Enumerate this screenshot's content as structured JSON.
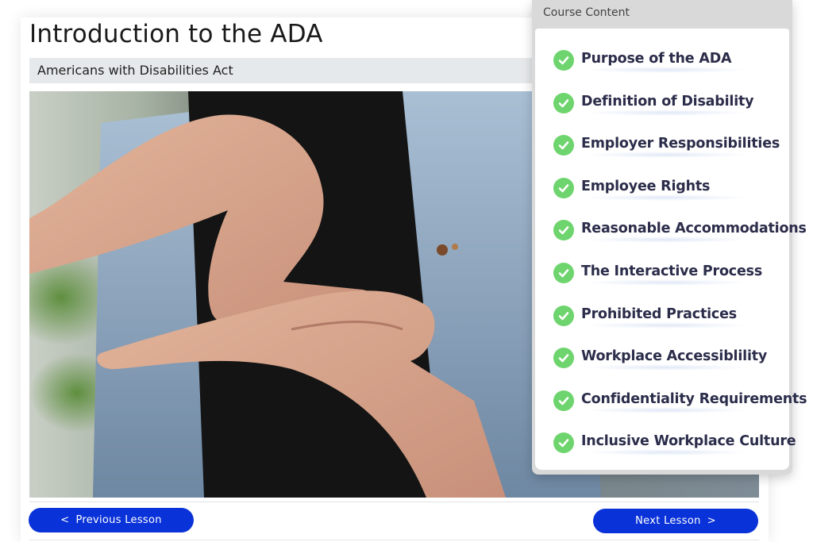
{
  "lesson": {
    "title": "Introduction to the ADA",
    "subtitle": "Americans with Disabilities Act"
  },
  "navigation": {
    "previous_label": "Previous Lesson",
    "next_label": "Next Lesson",
    "previous_icon": "chevron-left-icon",
    "next_icon": "chevron-right-icon",
    "button_color": "#0a32d9"
  },
  "media": {
    "icon": "sign-language-photo"
  },
  "course_content": {
    "header": "Course Content",
    "check_color": "#6ed46d",
    "items": [
      {
        "label": "Purpose of the ADA",
        "completed": true
      },
      {
        "label": "Definition of Disability",
        "completed": true
      },
      {
        "label": "Employer Responsibilities",
        "completed": true
      },
      {
        "label": "Employee Rights",
        "completed": true
      },
      {
        "label": "Reasonable Accommodations",
        "completed": true
      },
      {
        "label": "The Interactive Process",
        "completed": true
      },
      {
        "label": "Prohibited Practices",
        "completed": true
      },
      {
        "label": "Workplace Accessiblility",
        "completed": true
      },
      {
        "label": "Confidentiality Requirements",
        "completed": true
      },
      {
        "label": "Inclusive Workplace Culture",
        "completed": true
      }
    ]
  }
}
